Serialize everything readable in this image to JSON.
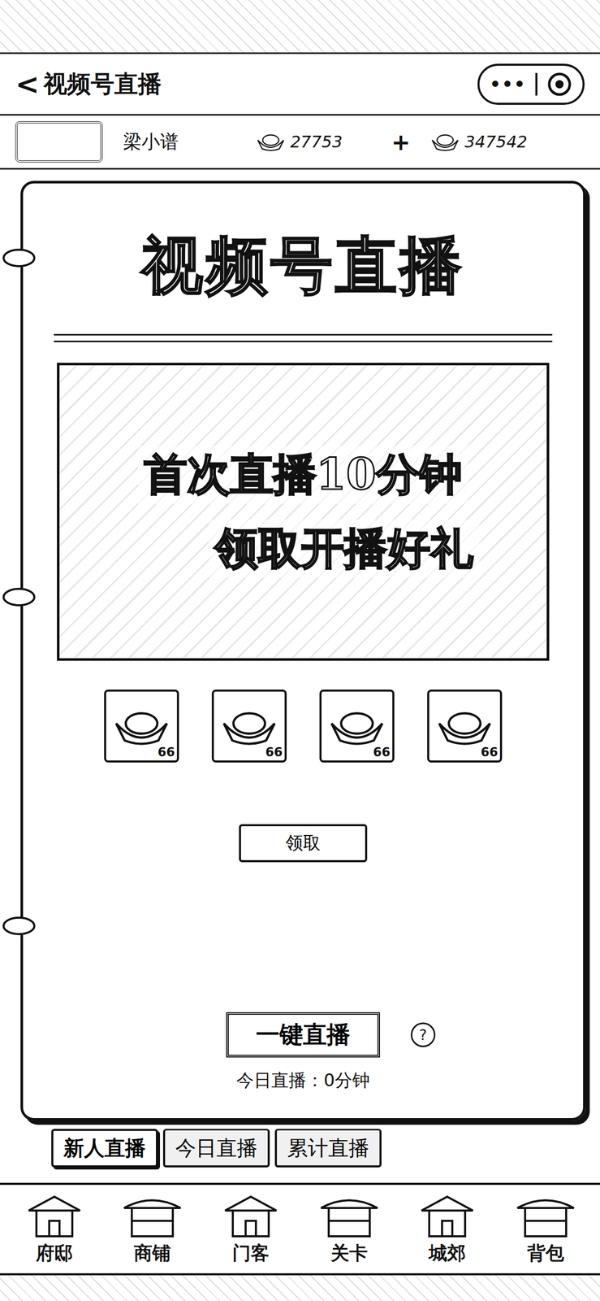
{
  "header": {
    "back": "<",
    "title": "视频号直播",
    "more": "•••"
  },
  "player": {
    "name": "梁小谱",
    "resources": [
      {
        "amount": "27753",
        "add": "+"
      },
      {
        "amount": "347542",
        "add": ""
      }
    ]
  },
  "panel": {
    "title": "视频号直播",
    "banner": {
      "lines": [
        "首次直播10分钟",
        "领取开播好礼"
      ]
    },
    "rewards": [
      {
        "count": "66"
      },
      {
        "count": "66"
      },
      {
        "count": "66"
      },
      {
        "count": "66"
      }
    ],
    "claim_button": "领取",
    "live_button": "一键直播",
    "help": "?",
    "today": "今日直播：0分钟"
  },
  "tabs": [
    {
      "label": "新人直播",
      "selected": true
    },
    {
      "label": "今日直播",
      "selected": false
    },
    {
      "label": "累计直播",
      "selected": false
    }
  ],
  "nav": [
    {
      "label": "府邸"
    },
    {
      "label": "商铺"
    },
    {
      "label": "门客"
    },
    {
      "label": "关卡"
    },
    {
      "label": "城郊"
    },
    {
      "label": "背包"
    }
  ]
}
